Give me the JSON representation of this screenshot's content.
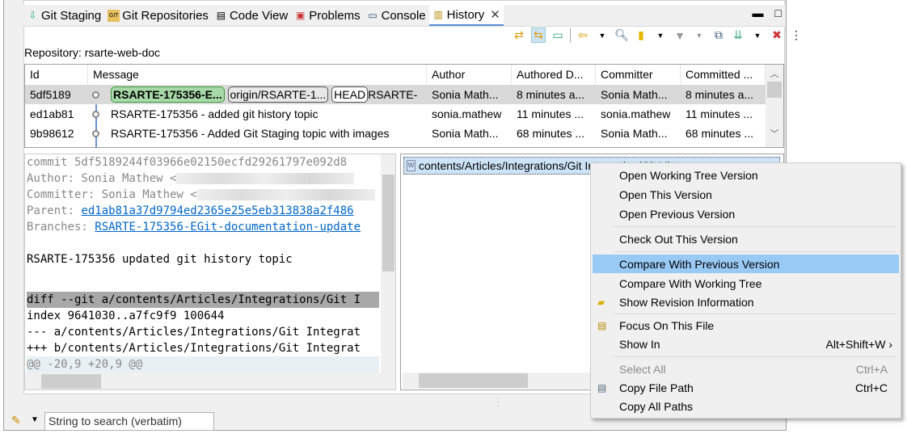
{
  "tabs": [
    {
      "label": "Git Staging",
      "icon": "git-staging-icon"
    },
    {
      "label": "Git Repositories",
      "icon": "git-repositories-icon"
    },
    {
      "label": "Code View",
      "icon": "code-view-icon"
    },
    {
      "label": "Problems",
      "icon": "problems-icon"
    },
    {
      "label": "Console",
      "icon": "console-icon"
    },
    {
      "label": "History",
      "icon": "history-icon",
      "active": true
    }
  ],
  "toolbar": [
    "link-with-selection-icon",
    "compare-mode-icon",
    "show-first-parent-icon",
    "show-all-branches-icon",
    "find-icon",
    "repository-icon",
    "filter-icon",
    "change-layout-icon",
    "show-additional-refs-icon",
    "remove-icon",
    "view-menu-icon"
  ],
  "repository_label": "Repository: rsarte-web-doc",
  "table": {
    "columns": [
      "Id",
      "Message",
      "Author",
      "Authored D...",
      "Committer",
      "Committed ..."
    ],
    "rows": [
      {
        "id": "5df5189",
        "badges": [
          "RSARTE-175356-E...",
          "origin/RSARTE-1...",
          "HEAD"
        ],
        "message": "RSARTE-",
        "author": "Sonia Math...",
        "authored": "8 minutes a...",
        "committer": "Sonia Math...",
        "committed": "8 minutes a...",
        "selected": true
      },
      {
        "id": "ed1ab81",
        "message": "RSARTE-175356 - added git history topic",
        "author": "sonia.mathew",
        "authored": "11 minutes ...",
        "committer": "sonia.mathew",
        "committed": "11 minutes ..."
      },
      {
        "id": "9b98612",
        "message": "RSARTE-175356 - Added Git Staging topic with images",
        "author": "Sonia Math...",
        "authored": "68 minutes ...",
        "committer": "Sonia Math...",
        "committed": "68 minutes ..."
      }
    ]
  },
  "details": {
    "commit": "commit 5df5189244f03966e02150ecfd29261797e092d8",
    "author": "Author: Sonia Mathew <",
    "committer": "Committer: Sonia Mathew <",
    "parent_label": "Parent: ",
    "parent": "ed1ab81a37d9794ed2365e25e5eb313838a2f486",
    "branches_label": "Branches: ",
    "branches": "RSARTE-175356-EGit-documentation-update",
    "message": "RSARTE-175356 updated git history topic",
    "diff": "diff --git a/contents/Articles/Integrations/Git I",
    "index": "index 9641030..a7fc9f9 100644",
    "minus": "--- a/contents/Articles/Integrations/Git Integrat",
    "plus": "+++ b/contents/Articles/Integrations/Git Integrat",
    "hunk": "@@ -20,9 +20,9 @@"
  },
  "file": "contents/Articles/Integrations/Git Integration/Git History",
  "menu": [
    {
      "label": "Open Working Tree Version"
    },
    {
      "label": "Open This Version"
    },
    {
      "label": "Open Previous Version"
    },
    {
      "label": "Check Out This Version"
    },
    {
      "label": "Compare With Previous Version",
      "highlighted": true
    },
    {
      "label": "Compare With Working Tree"
    },
    {
      "label": "Show Revision Information",
      "icon": "revision-info-icon"
    },
    {
      "label": "Focus On This File",
      "icon": "focus-file-icon"
    },
    {
      "label": "Show In",
      "shortcut": "Alt+Shift+W",
      "submenu": true
    },
    {
      "label": "Select All",
      "shortcut": "Ctrl+A",
      "disabled": true
    },
    {
      "label": "Copy File Path",
      "shortcut": "Ctrl+C",
      "icon": "copy-icon"
    },
    {
      "label": "Copy All Paths"
    }
  ],
  "search": {
    "placeholder": "String to search (verbatim)"
  }
}
